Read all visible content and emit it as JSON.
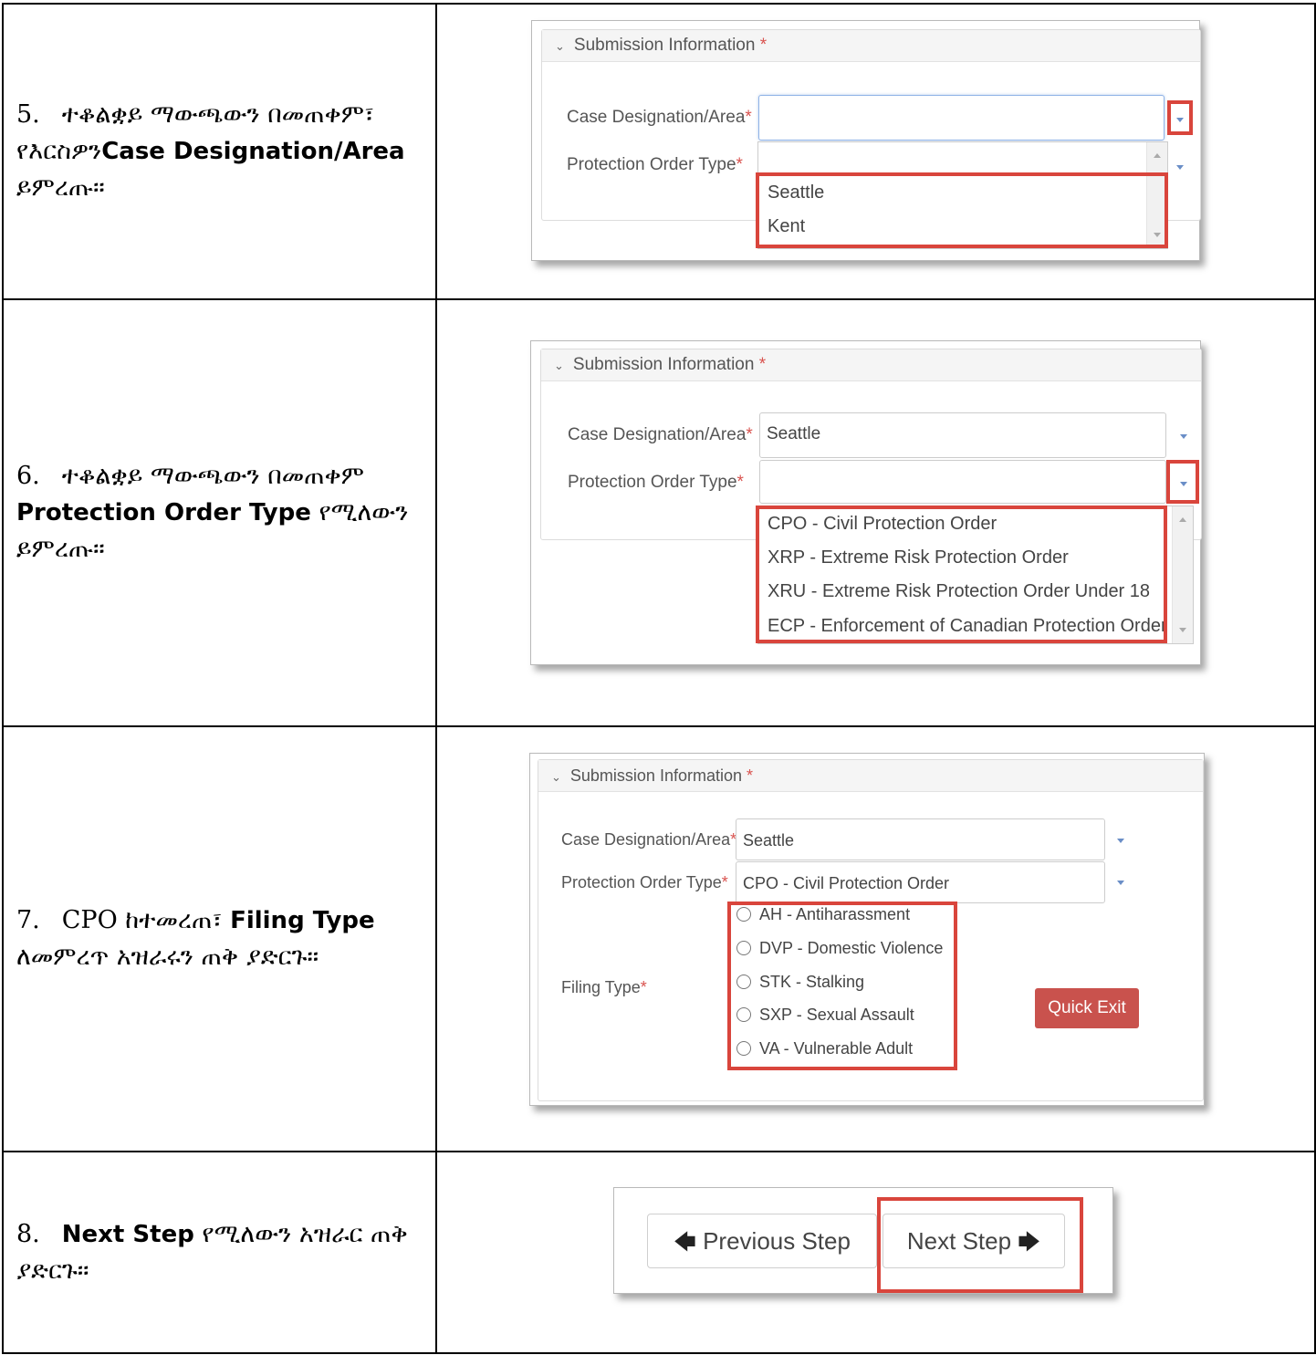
{
  "rows": [
    {
      "number": "5.",
      "text_parts": [
        "ተቆልቋይ ማውጫውን በመጠቀም፣ የእርስዎን",
        "Case Designation/Area",
        " ይምረጡ።"
      ]
    },
    {
      "number": "6.",
      "text_parts": [
        "ተቆልቋይ ማውጫውን በመጠቀም ",
        "Protection Order Type",
        " የሚለውን ይምረጡ።"
      ]
    },
    {
      "number": "7.",
      "text_parts": [
        "CPO ከተመረጠ፣ ",
        "Filing Type",
        " ለመምረጥ አዝራሩን ጠቅ ያድርጉ።"
      ]
    },
    {
      "number": "8.",
      "text_parts": [
        "",
        "Next Step",
        " የሚለውን አዝራር ጠቅ ያድርጉ።"
      ]
    }
  ],
  "form": {
    "section_title": "Submission Information",
    "required_mark": "*",
    "case_label": "Case Designation/Area",
    "order_label": "Protection Order Type",
    "filing_label": "Filing Type",
    "case_value": "Seattle",
    "order_value": "CPO - Civil Protection Order",
    "case_options": [
      "Seattle",
      "Kent"
    ],
    "order_options": [
      "CPO - Civil Protection Order",
      "XRP - Extreme Risk Protection Order",
      "XRU - Extreme Risk Protection Order Under 18",
      "ECP - Enforcement of Canadian Protection Order"
    ],
    "filing_options": [
      "AH - Antiharassment",
      "DVP - Domestic Violence",
      "STK - Stalking",
      "SXP - Sexual Assault",
      "VA - Vulnerable Adult"
    ],
    "quick_exit": "Quick Exit"
  },
  "steps": {
    "previous": "Previous Step",
    "next": "Next Step"
  },
  "colors": {
    "highlight_red": "#d9453c",
    "quick_exit_bg": "#c9524d"
  }
}
